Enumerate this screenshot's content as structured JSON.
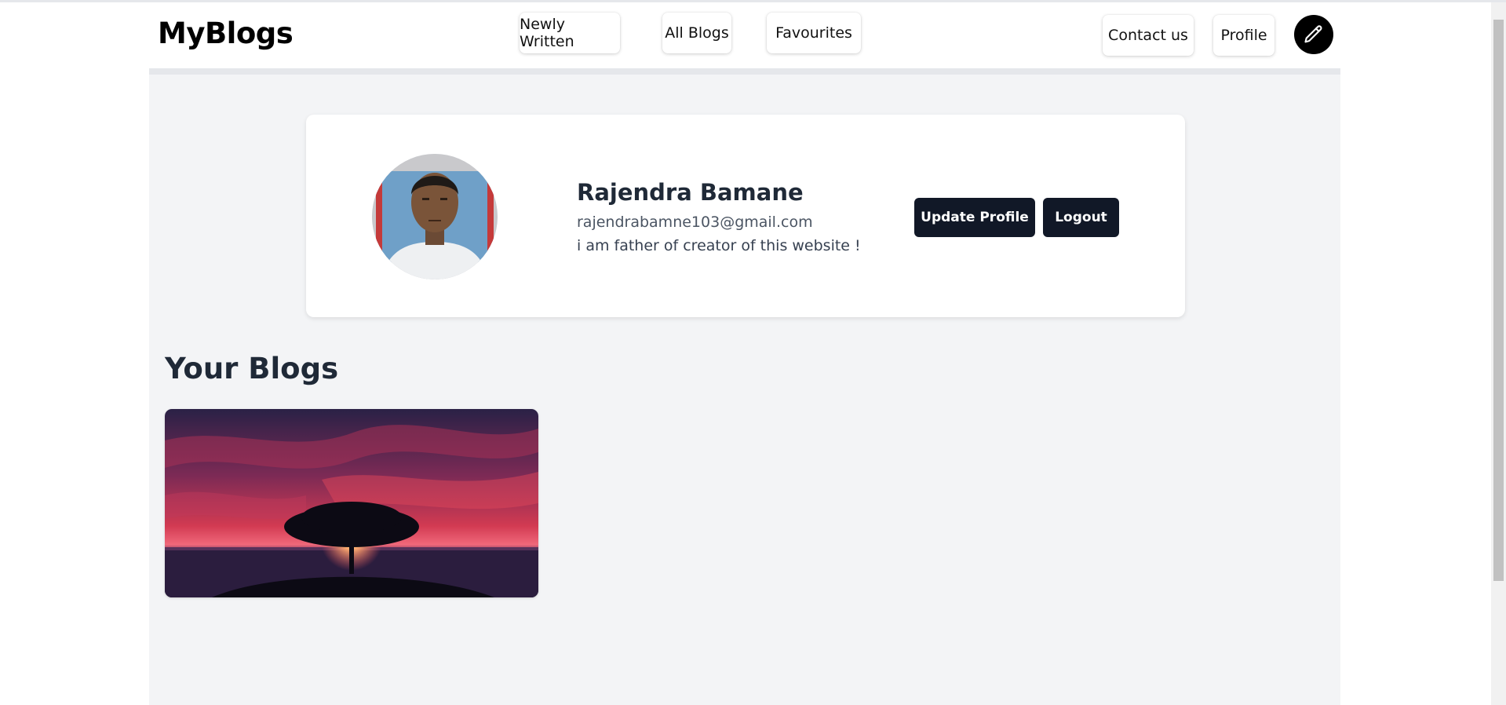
{
  "app": {
    "logo": "MyBlogs"
  },
  "nav": {
    "newly_written": "Newly Written",
    "all_blogs": "All Blogs",
    "favourites": "Favourites",
    "contact_us": "Contact us",
    "profile": "Profile",
    "write_icon": "pencil-icon"
  },
  "profile": {
    "name": "Rajendra Bamane",
    "email": "rajendrabamne103@gmail.com",
    "bio": "i am father of creator of this website !",
    "update_label": "Update Profile",
    "logout_label": "Logout"
  },
  "blogs": {
    "section_title": "Your Blogs",
    "items": [
      {
        "image": "sunset-tree-image"
      }
    ]
  },
  "colors": {
    "page_bg": "#f3f4f6",
    "dark_button": "#111827",
    "accent_black": "#000000"
  }
}
